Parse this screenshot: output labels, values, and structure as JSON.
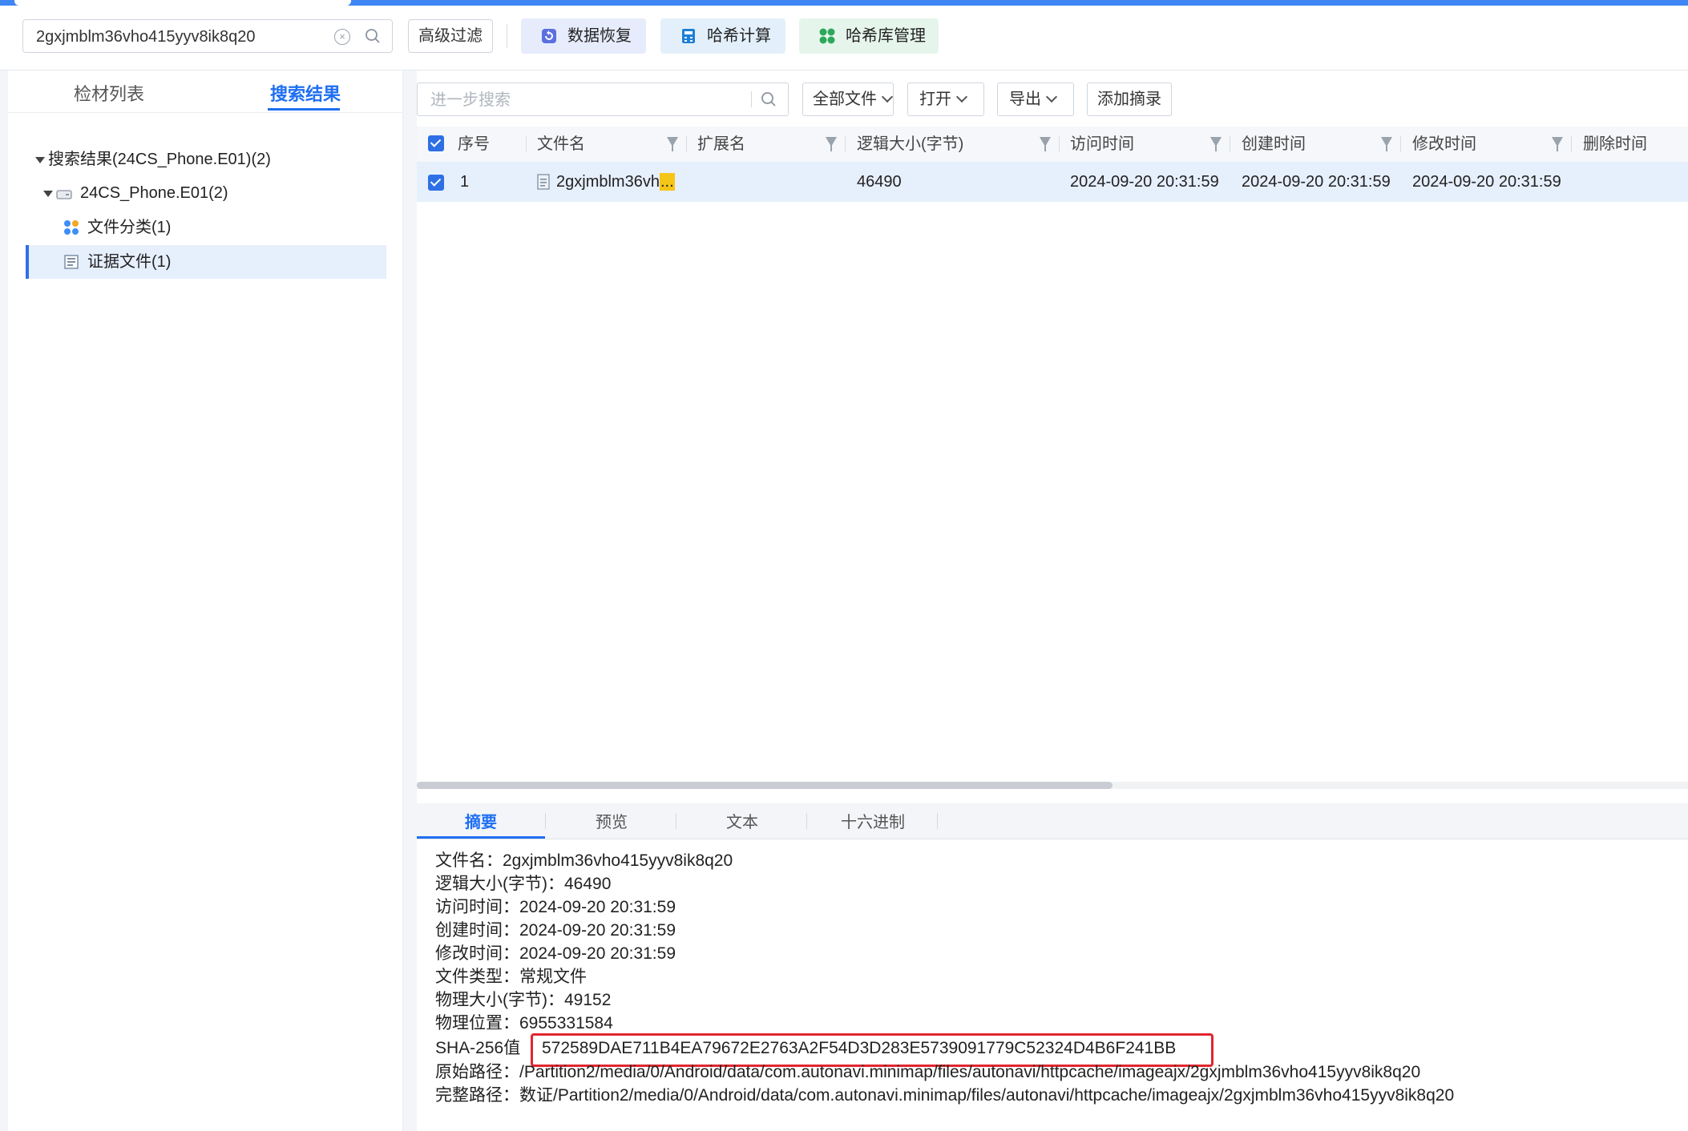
{
  "toolbar": {
    "search_value": "2gxjmblm36vho415yyv8ik8q20",
    "advanced_filter_label": "高级过滤",
    "data_recovery_label": "数据恢复",
    "hash_compute_label": "哈希计算",
    "hash_library_label": "哈希库管理",
    "colors": {
      "recovery_bg": "#e6ecfb",
      "hash_bg": "#e3f0fb",
      "library_bg": "#e6f5ec",
      "accent": "#1f6ff2"
    }
  },
  "left_panel": {
    "tabs": [
      {
        "label": "检材列表",
        "active": false
      },
      {
        "label": "搜索结果",
        "active": true
      }
    ],
    "tree": [
      {
        "label": "搜索结果(24CS_Phone.E01)(2)",
        "level": 0,
        "icon": "expand-caret"
      },
      {
        "label": "24CS_Phone.E01(2)",
        "level": 1,
        "icon": "drive-icon"
      },
      {
        "label": "文件分类(1)",
        "level": 2,
        "icon": "category-icon"
      },
      {
        "label": "证据文件(1)",
        "level": 2,
        "icon": "evidence-file-icon",
        "selected": true
      }
    ]
  },
  "right_panel": {
    "search_placeholder": "进一步搜索",
    "filter_select": "全部文件",
    "open_label": "打开",
    "export_label": "导出",
    "add_summary_label": "添加摘录",
    "columns": [
      "序号",
      "文件名",
      "扩展名",
      "逻辑大小(字节)",
      "访问时间",
      "创建时间",
      "修改时间",
      "删除时间"
    ],
    "rows": [
      {
        "index": "1",
        "name": "2gxjmblm36vh",
        "name_more": "...",
        "ext": "",
        "size": "46490",
        "accessed": "2024-09-20 20:31:59",
        "created": "2024-09-20 20:31:59",
        "modified": "2024-09-20 20:31:59",
        "deleted": ""
      }
    ]
  },
  "bottom_tabs": [
    {
      "label": "摘要",
      "active": true
    },
    {
      "label": "预览",
      "active": false
    },
    {
      "label": "文本",
      "active": false
    },
    {
      "label": "十六进制",
      "active": false
    }
  ],
  "summary": {
    "filename": "文件名：2gxjmblm36vho415yyv8ik8q20",
    "logical_size": "逻辑大小(字节)：46490",
    "access_time": "访问时间：2024-09-20 20:31:59",
    "create_time": "创建时间：2024-09-20 20:31:59",
    "modify_time": "修改时间：2024-09-20 20:31:59",
    "file_type": "文件类型：常规文件",
    "physical_size": "物理大小(字节)：49152",
    "physical_location": "物理位置：6955331584",
    "sha256_label": "SHA-256值",
    "sha256_value": "572589DAE711B4EA79672E2763A2F54D3D283E5739091779C52324D4B6F241BB",
    "original_path": "原始路径：/Partition2/media/0/Android/data/com.autonavi.minimap/files/autonavi/httpcache/imageajx/2gxjmblm36vho415yyv8ik8q20",
    "full_path": "完整路径：数证/Partition2/media/0/Android/data/com.autonavi.minimap/files/autonavi/httpcache/imageajx/2gxjmblm36vho415yyv8ik8q20"
  }
}
